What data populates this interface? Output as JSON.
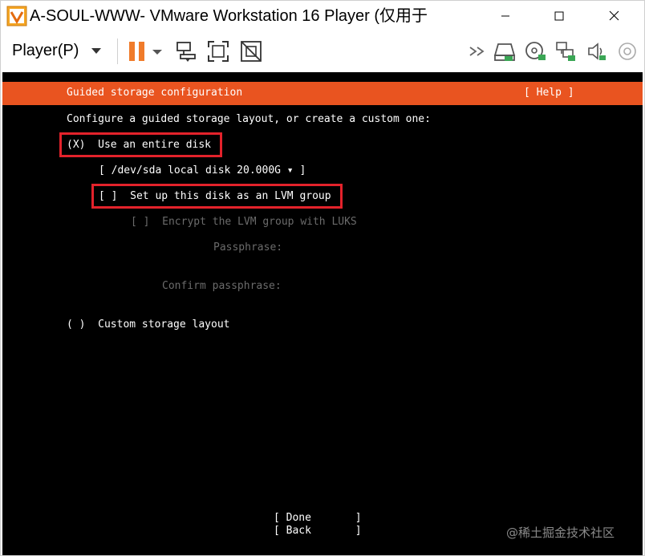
{
  "window": {
    "title": "A-SOUL-WWW- VMware Workstation 16 Player (仅用于",
    "app_icon": "vmware-icon",
    "minimize_icon": "minimize-icon",
    "maximize_icon": "maximize-icon",
    "close_icon": "close-icon"
  },
  "toolbar": {
    "player_menu_label": "Player(P)",
    "icons": [
      "pause-icon",
      "pause-dropdown-icon",
      "send-ctrl-alt-del-icon",
      "fullscreen-icon",
      "unity-icon",
      "more-devices-icon",
      "hard-disk-icon",
      "cd-dvd-icon",
      "network-adapter-icon",
      "sound-icon",
      "usb-device-icon"
    ]
  },
  "installer": {
    "header_title": "Guided storage configuration",
    "help_label": "[ Help ]",
    "intro": "Configure a guided storage layout, or create a custom one:",
    "option_entire_disk": "(X)  Use an entire disk",
    "disk_select": "[ /dev/sda local disk 20.000G ▾ ]",
    "lvm_checkbox": "[ ]  Set up this disk as an LVM group",
    "encrypt_checkbox": "[ ]  Encrypt the LVM group with LUKS",
    "passphrase_label": "Passphrase:",
    "confirm_passphrase_label": "Confirm passphrase:",
    "option_custom": "( )  Custom storage layout",
    "done_button": "[ Done       ]",
    "back_button": "[ Back       ]"
  },
  "watermark": "@稀土掘金技术社区",
  "colors": {
    "header_orange": "#e95420",
    "highlight_red": "#e3222b",
    "pause_orange": "#f07b2a",
    "screen_bg": "#000000"
  }
}
